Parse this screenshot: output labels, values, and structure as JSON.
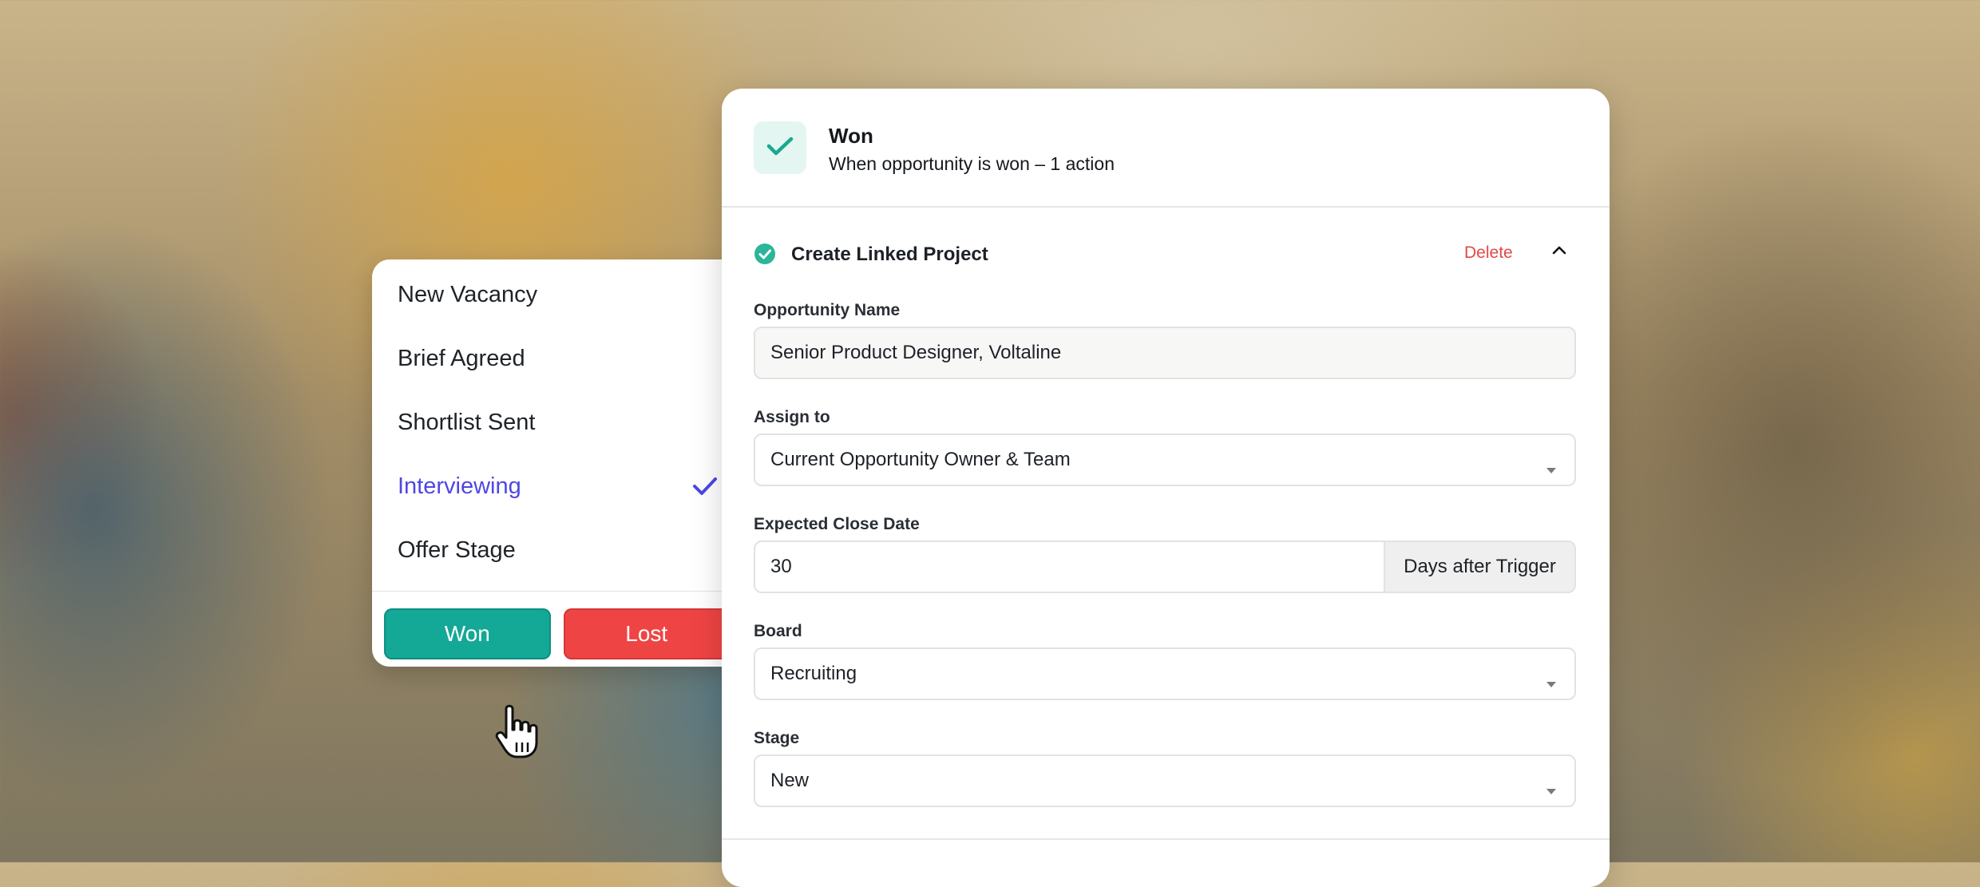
{
  "stage_menu": {
    "items": [
      {
        "label": "New Vacancy",
        "selected": false
      },
      {
        "label": "Brief Agreed",
        "selected": false
      },
      {
        "label": "Shortlist Sent",
        "selected": false
      },
      {
        "label": "Interviewing",
        "selected": true
      },
      {
        "label": "Offer Stage",
        "selected": false
      }
    ],
    "won_label": "Won",
    "lost_label": "Lost",
    "selected_color": "#4f46e5",
    "won_color": "#14a896",
    "lost_color": "#ef4444"
  },
  "trigger": {
    "title": "Won",
    "subtitle": "When opportunity is won – 1 action",
    "icon": "check-icon"
  },
  "action": {
    "title": "Create Linked Project",
    "delete_label": "Delete",
    "fields": {
      "opportunity_name": {
        "label": "Opportunity Name",
        "value": "Senior Product Designer, Voltaline"
      },
      "assign_to": {
        "label": "Assign to",
        "value": "Current Opportunity Owner & Team"
      },
      "expected_close": {
        "label": "Expected Close Date",
        "value": "30",
        "suffix": "Days after Trigger"
      },
      "board": {
        "label": "Board",
        "value": "Recruiting"
      },
      "stage": {
        "label": "Stage",
        "value": "New"
      }
    }
  }
}
